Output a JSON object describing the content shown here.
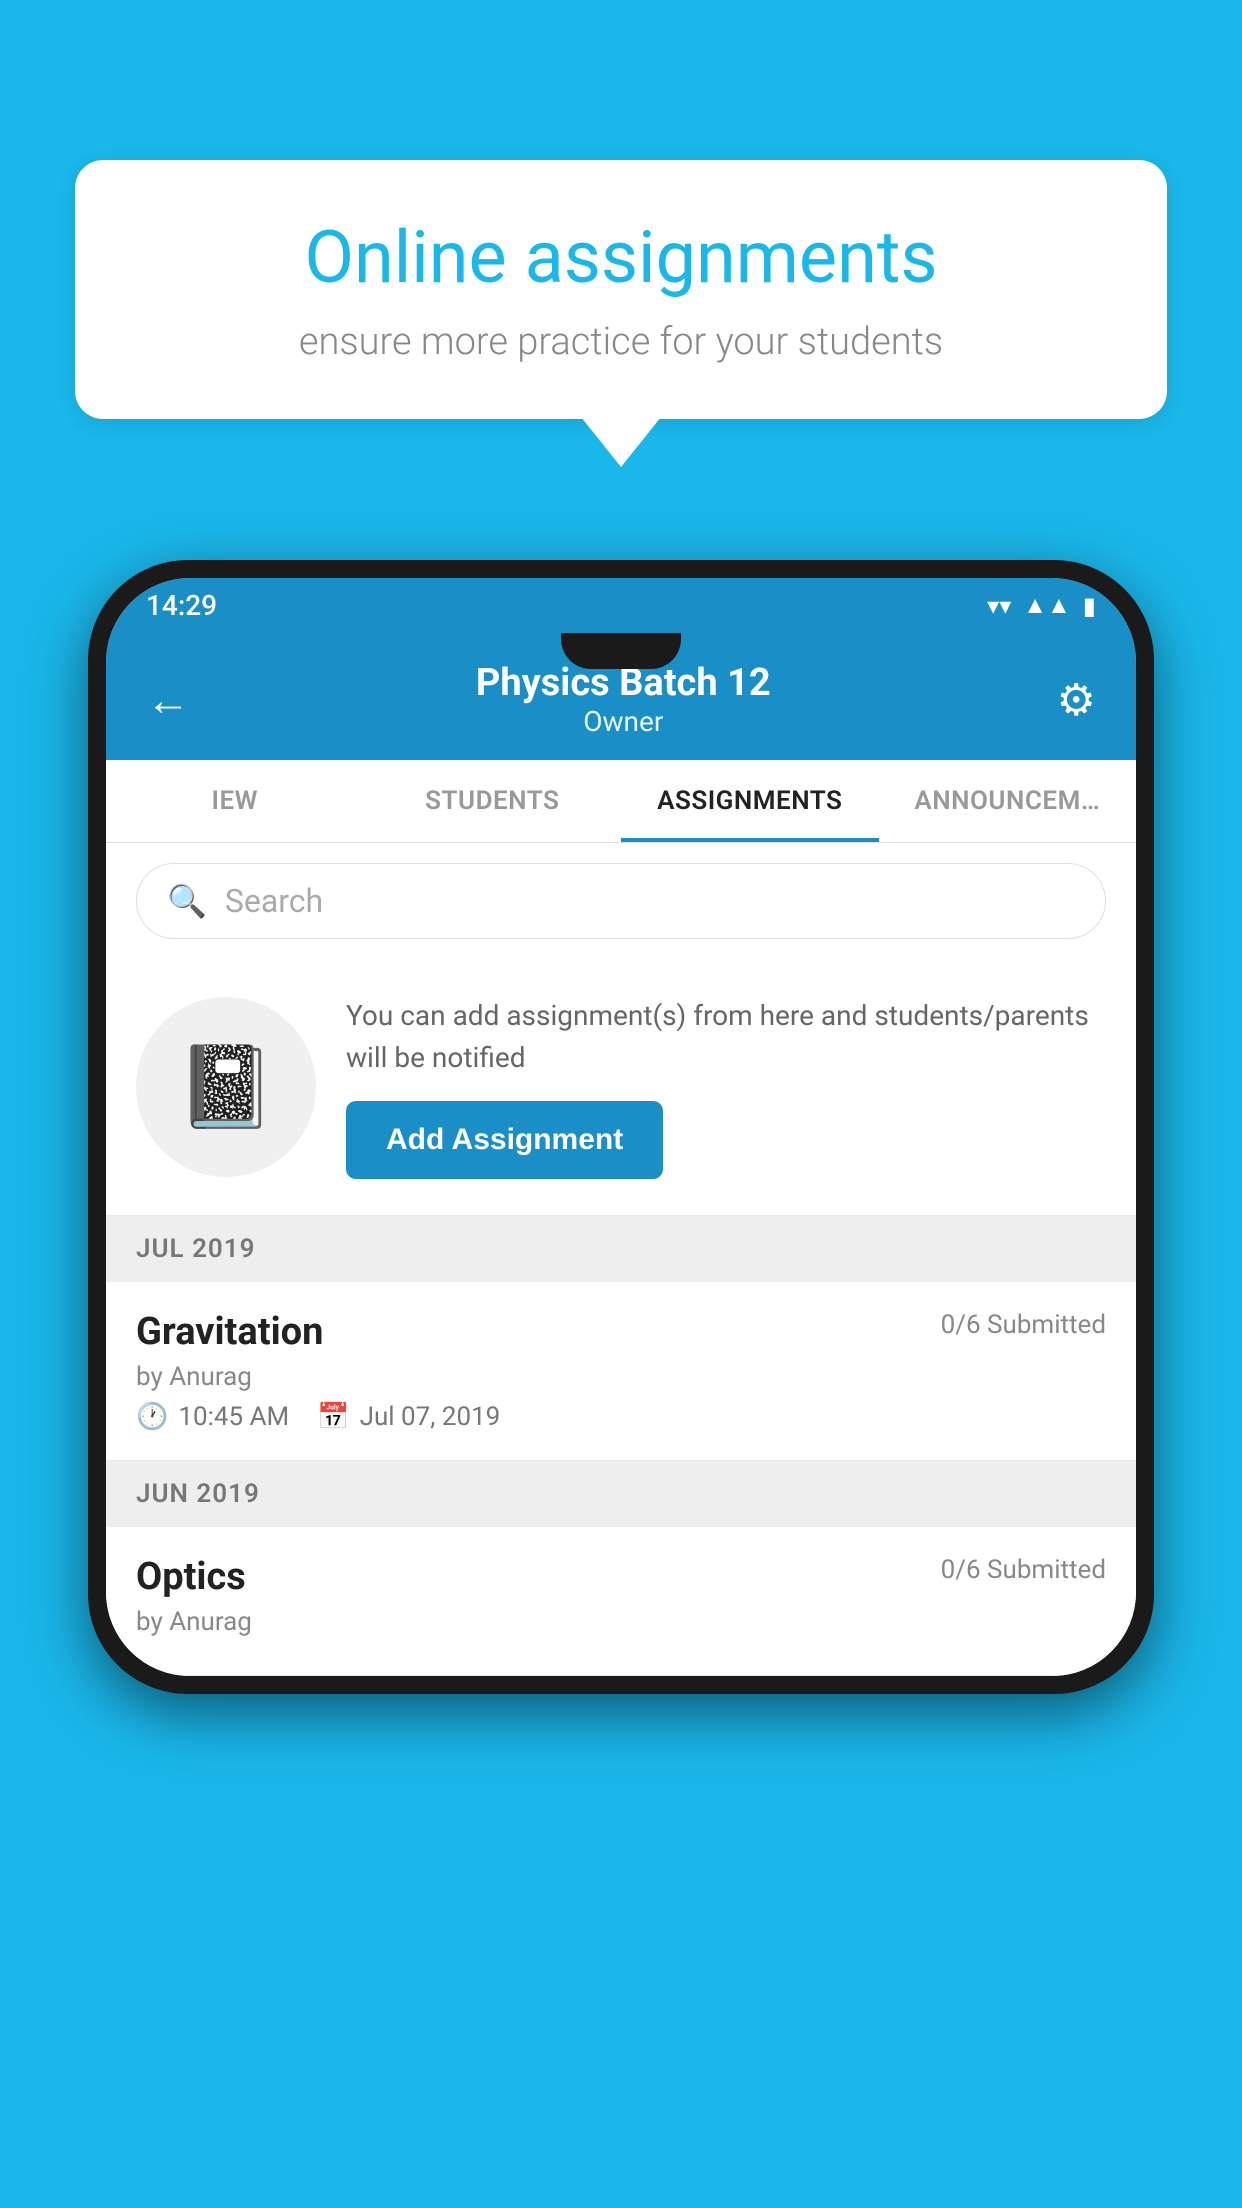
{
  "background": {
    "color": "#1ab7ea"
  },
  "speech_bubble": {
    "title": "Online assignments",
    "subtitle": "ensure more practice for your students"
  },
  "status_bar": {
    "time": "14:29",
    "icons": [
      "wifi",
      "signal",
      "battery"
    ]
  },
  "app_header": {
    "title": "Physics Batch 12",
    "subtitle": "Owner",
    "back_label": "←",
    "settings_label": "⚙"
  },
  "tabs": [
    {
      "label": "IEW",
      "active": false
    },
    {
      "label": "STUDENTS",
      "active": false
    },
    {
      "label": "ASSIGNMENTS",
      "active": true
    },
    {
      "label": "ANNOUNCEM…",
      "active": false
    }
  ],
  "search": {
    "placeholder": "Search"
  },
  "promo": {
    "text": "You can add assignment(s) from here and students/parents will be notified",
    "button_label": "Add Assignment"
  },
  "month_groups": [
    {
      "month_label": "JUL 2019",
      "assignments": [
        {
          "name": "Gravitation",
          "submitted": "0/6 Submitted",
          "author": "by Anurag",
          "time": "10:45 AM",
          "date": "Jul 07, 2019"
        }
      ]
    },
    {
      "month_label": "JUN 2019",
      "assignments": [
        {
          "name": "Optics",
          "submitted": "0/6 Submitted",
          "author": "by Anurag",
          "time": "",
          "date": ""
        }
      ]
    }
  ]
}
